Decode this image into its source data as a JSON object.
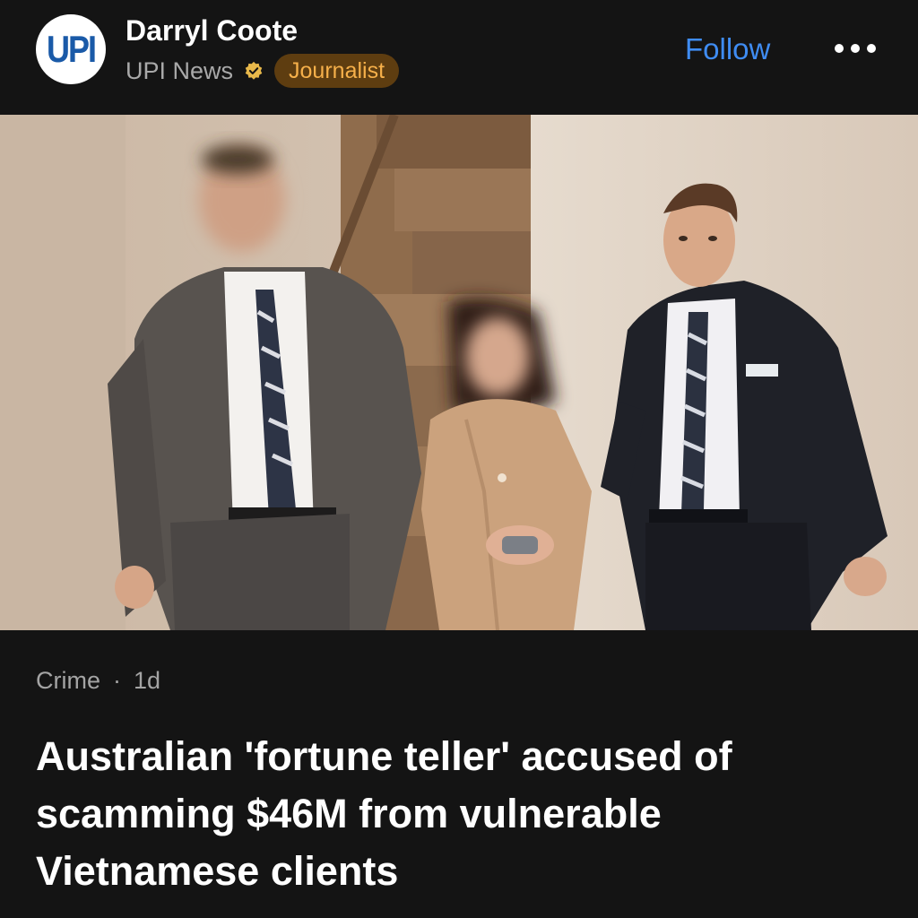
{
  "author": {
    "name": "Darryl Coote",
    "avatar_text": "UPI",
    "source": "UPI News",
    "role_badge": "Journalist"
  },
  "actions": {
    "follow_label": "Follow",
    "more_icon": "more-horizontal-icon"
  },
  "image": {
    "description": "Three people walking down a stairway in a hallway: a man in a grey suit, a woman in a beige coat with handcuffs, and a man in a dark suit"
  },
  "article": {
    "category": "Crime",
    "separator": "·",
    "age": "1d",
    "headline": "Australian 'fortune teller' accused of scamming $46M from vulnerable Vietnamese clients"
  },
  "colors": {
    "background": "#141414",
    "follow_blue": "#3f8cf2",
    "badge_bg": "#5e3d10",
    "badge_text": "#f6b04a",
    "verified_gold": "#e8b84a"
  }
}
